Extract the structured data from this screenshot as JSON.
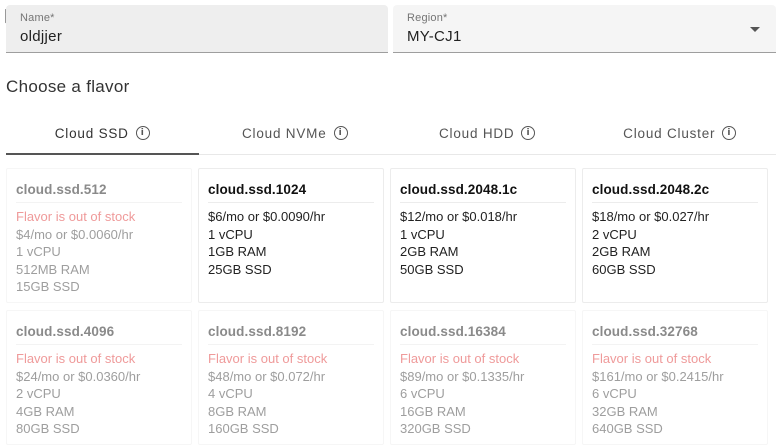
{
  "form": {
    "name": {
      "label": "Name*",
      "value": "oldjjer"
    },
    "region": {
      "label": "Region*",
      "value": "MY-CJ1"
    }
  },
  "section_title": "Choose a flavor",
  "tabs": [
    {
      "label": "Cloud SSD",
      "active": true
    },
    {
      "label": "Cloud NVMe",
      "active": false
    },
    {
      "label": "Cloud HDD",
      "active": false
    },
    {
      "label": "Cloud Cluster",
      "active": false
    }
  ],
  "flavors": [
    {
      "name": "cloud.ssd.512",
      "status": "Flavor is out of stock",
      "price": "$4/mo or $0.0060/hr",
      "cpu": "1 vCPU",
      "ram": "512MB RAM",
      "disk": "15GB SSD"
    },
    {
      "name": "cloud.ssd.1024",
      "status": "",
      "price": "$6/mo or $0.0090/hr",
      "cpu": "1 vCPU",
      "ram": "1GB RAM",
      "disk": "25GB SSD"
    },
    {
      "name": "cloud.ssd.2048.1c",
      "status": "",
      "price": "$12/mo or $0.018/hr",
      "cpu": "1 vCPU",
      "ram": "2GB RAM",
      "disk": "50GB SSD"
    },
    {
      "name": "cloud.ssd.2048.2c",
      "status": "",
      "price": "$18/mo or $0.027/hr",
      "cpu": "2 vCPU",
      "ram": "2GB RAM",
      "disk": "60GB SSD"
    },
    {
      "name": "cloud.ssd.4096",
      "status": "Flavor is out of stock",
      "price": "$24/mo or $0.0360/hr",
      "cpu": "2 vCPU",
      "ram": "4GB RAM",
      "disk": "80GB SSD"
    },
    {
      "name": "cloud.ssd.8192",
      "status": "Flavor is out of stock",
      "price": "$48/mo or $0.072/hr",
      "cpu": "4 vCPU",
      "ram": "8GB RAM",
      "disk": "160GB SSD"
    },
    {
      "name": "cloud.ssd.16384",
      "status": "Flavor is out of stock",
      "price": "$89/mo or $0.1335/hr",
      "cpu": "6 vCPU",
      "ram": "16GB RAM",
      "disk": "320GB SSD"
    },
    {
      "name": "cloud.ssd.32768",
      "status": "Flavor is out of stock",
      "price": "$161/mo or $0.2415/hr",
      "cpu": "6 vCPU",
      "ram": "32GB RAM",
      "disk": "640GB SSD"
    }
  ],
  "colors": {
    "out_of_stock": "#ef9a9a",
    "field_bg": "#eeeeee",
    "tab_indicator": "#555555"
  }
}
